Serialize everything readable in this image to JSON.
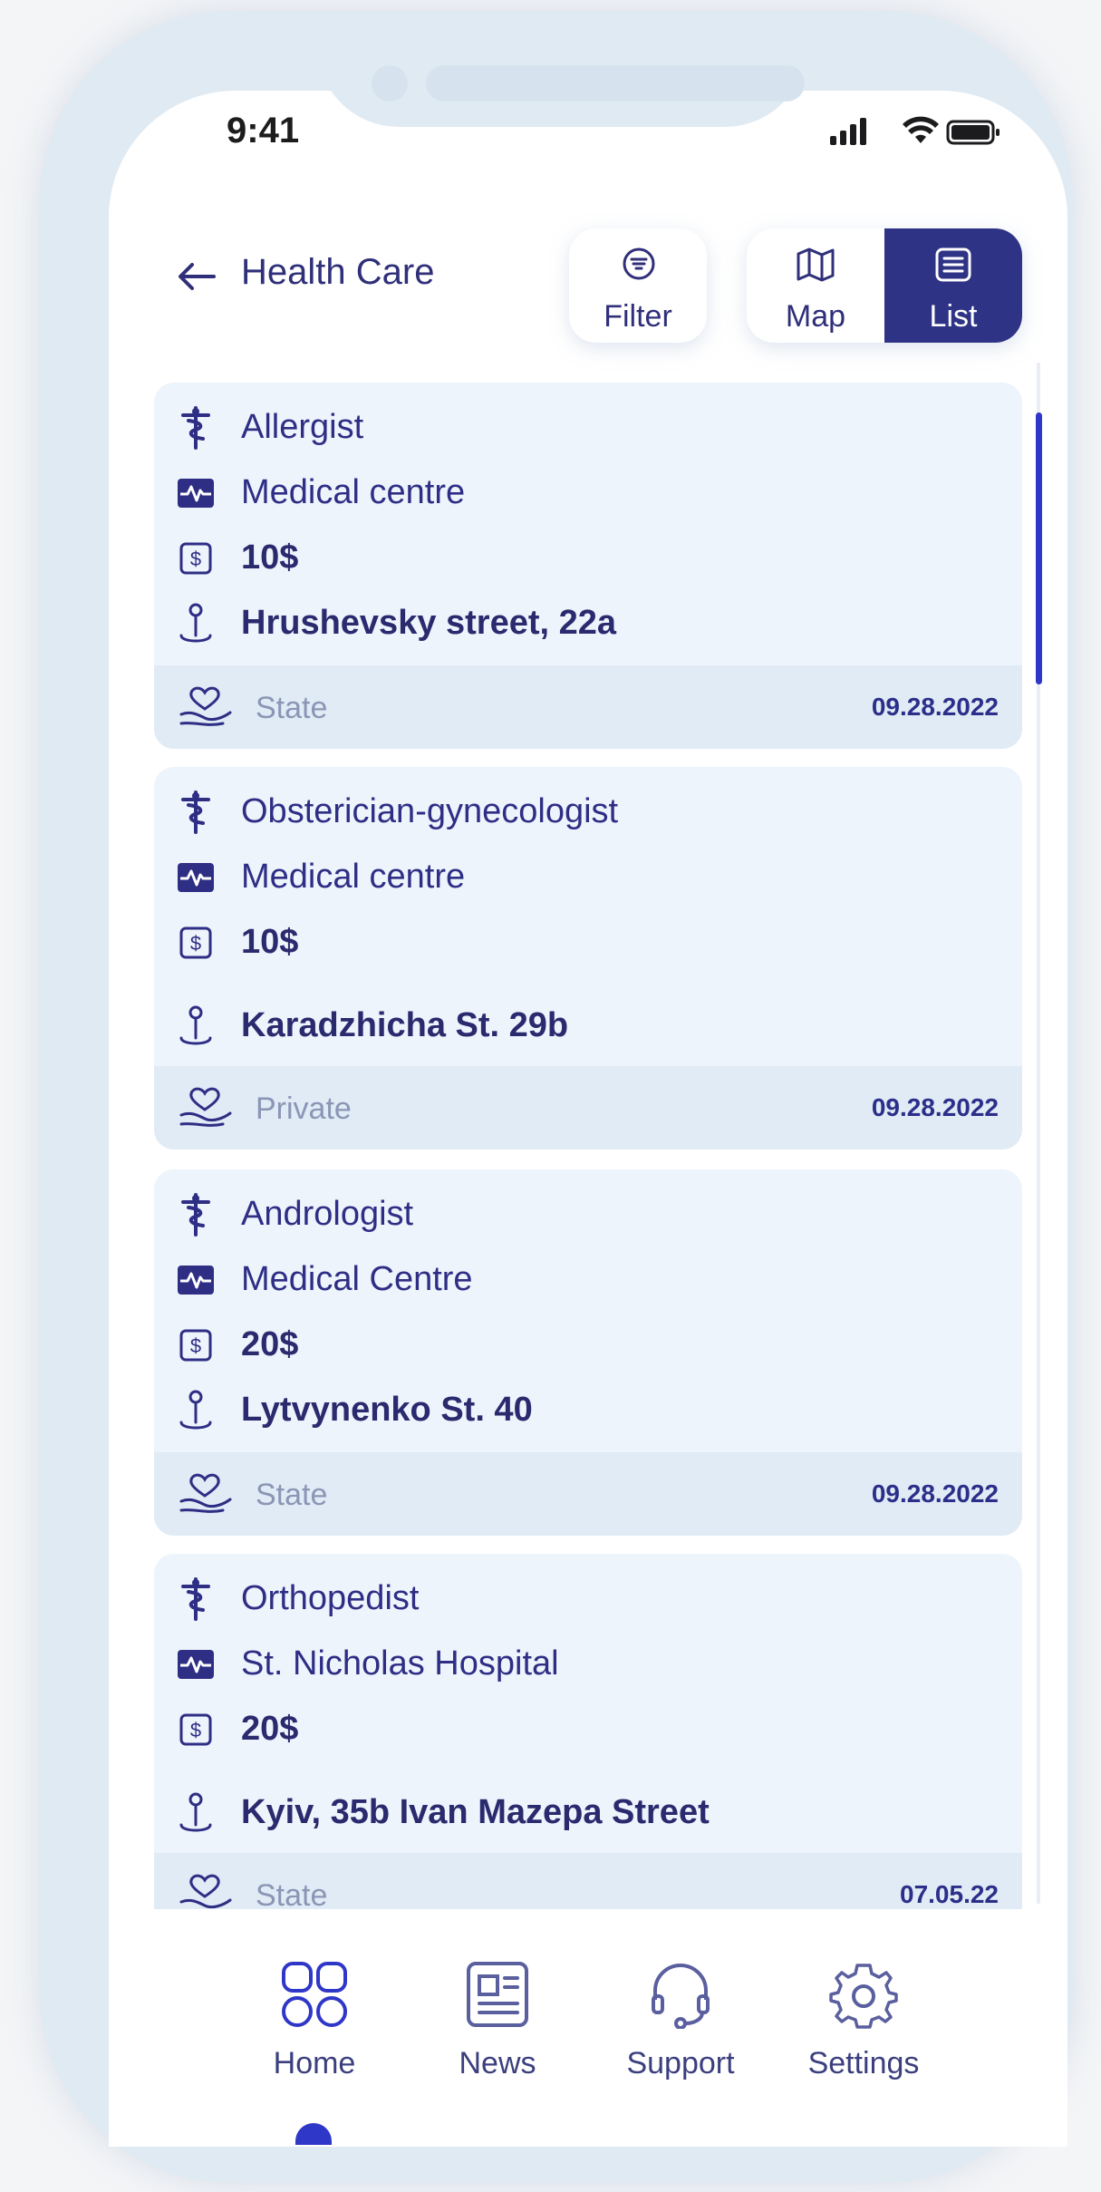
{
  "status_bar": {
    "time": "9:41"
  },
  "header": {
    "title": "Health Care",
    "filter_label": "Filter",
    "map_label": "Map",
    "list_label": "List",
    "active_view": "List"
  },
  "colors": {
    "accent": "#2e3386",
    "text": "#2e2e85",
    "card_bg": "#eef4fc",
    "footer_bg": "#e0ebf5"
  },
  "cards": [
    {
      "specialty": "Allergist",
      "facility": "Medical centre",
      "price": "10$",
      "address": "Hrushevsky street, 22a",
      "type": "State",
      "date": "09.28.2022"
    },
    {
      "specialty": "Obsterician-gynecologist",
      "facility": "Medical centre",
      "price": "10$",
      "address": "Karadzhicha St. 29b",
      "type": "Private",
      "date": "09.28.2022"
    },
    {
      "specialty": "Andrologist",
      "facility": "Medical Centre",
      "price": "20$",
      "address": "Lytvynenko St. 40",
      "type": "State",
      "date": "09.28.2022"
    },
    {
      "specialty": "Orthopedist",
      "facility": "St. Nicholas Hospital",
      "price": "20$",
      "address": "Kyiv, 35b Ivan Mazepa Street",
      "type": "State",
      "date": "07.05.22"
    }
  ],
  "tabs": [
    {
      "label": "Home",
      "icon": "grid-icon",
      "active": true
    },
    {
      "label": "News",
      "icon": "news-icon",
      "active": false
    },
    {
      "label": "Support",
      "icon": "headset-icon",
      "active": false
    },
    {
      "label": "Settings",
      "icon": "gear-icon",
      "active": false
    }
  ]
}
